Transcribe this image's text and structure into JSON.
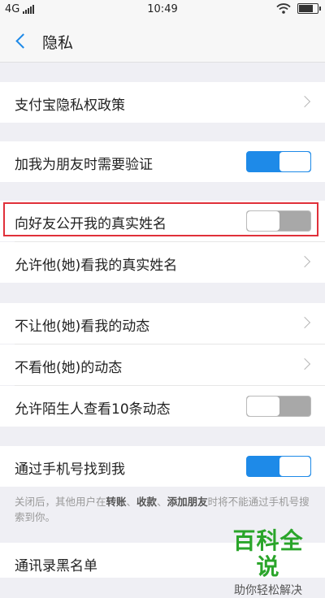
{
  "status_bar": {
    "network": "4G",
    "time": "10:49"
  },
  "header": {
    "title": "隐私"
  },
  "rows": {
    "alipay_policy": "支付宝隐私权政策",
    "verify_friend": {
      "label": "加我为朋友时需要验证",
      "enabled": true
    },
    "show_real_name": {
      "label": "向好友公开我的真实姓名",
      "enabled": false
    },
    "allow_view_real_name": "允许他(她)看我的真实姓名",
    "hide_my_moments": "不让他(她)看我的动态",
    "hide_their_moments": "不看他(她)的动态",
    "stranger_moments": {
      "label": "允许陌生人查看10条动态",
      "enabled": false
    },
    "find_by_phone": {
      "label": "通过手机号找到我",
      "enabled": true
    },
    "contacts_blacklist": "通讯录黑名单"
  },
  "footnote": {
    "before": "关闭后，其他用户在",
    "transfer": "转账",
    "sep1": "、",
    "collect": "收款",
    "sep2": "、",
    "add_friend": "添加朋友",
    "after": "时将不能通过手机号搜索到你。"
  },
  "watermark": {
    "title": "百科全说",
    "subtitle": "助你轻松解决"
  },
  "colors": {
    "toggle_on": "#1e8ae8",
    "toggle_off": "#a8a8a8",
    "highlight": "#e0303a",
    "watermark": "#2aa52a"
  }
}
